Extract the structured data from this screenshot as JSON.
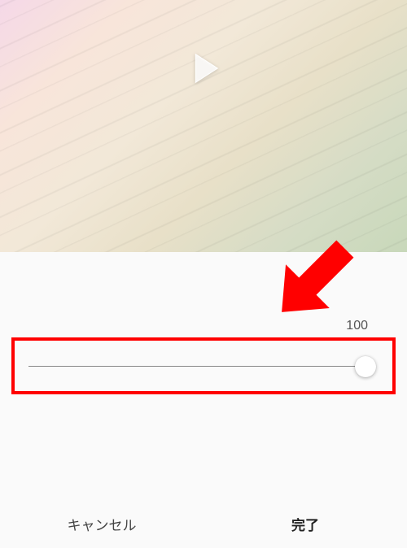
{
  "slider": {
    "value": "100",
    "min": 0,
    "max": 100,
    "current": 100
  },
  "buttons": {
    "cancel": "キャンセル",
    "done": "完了"
  },
  "annotation": {
    "arrow_color": "#ff0000",
    "highlight_color": "#ff0000"
  }
}
